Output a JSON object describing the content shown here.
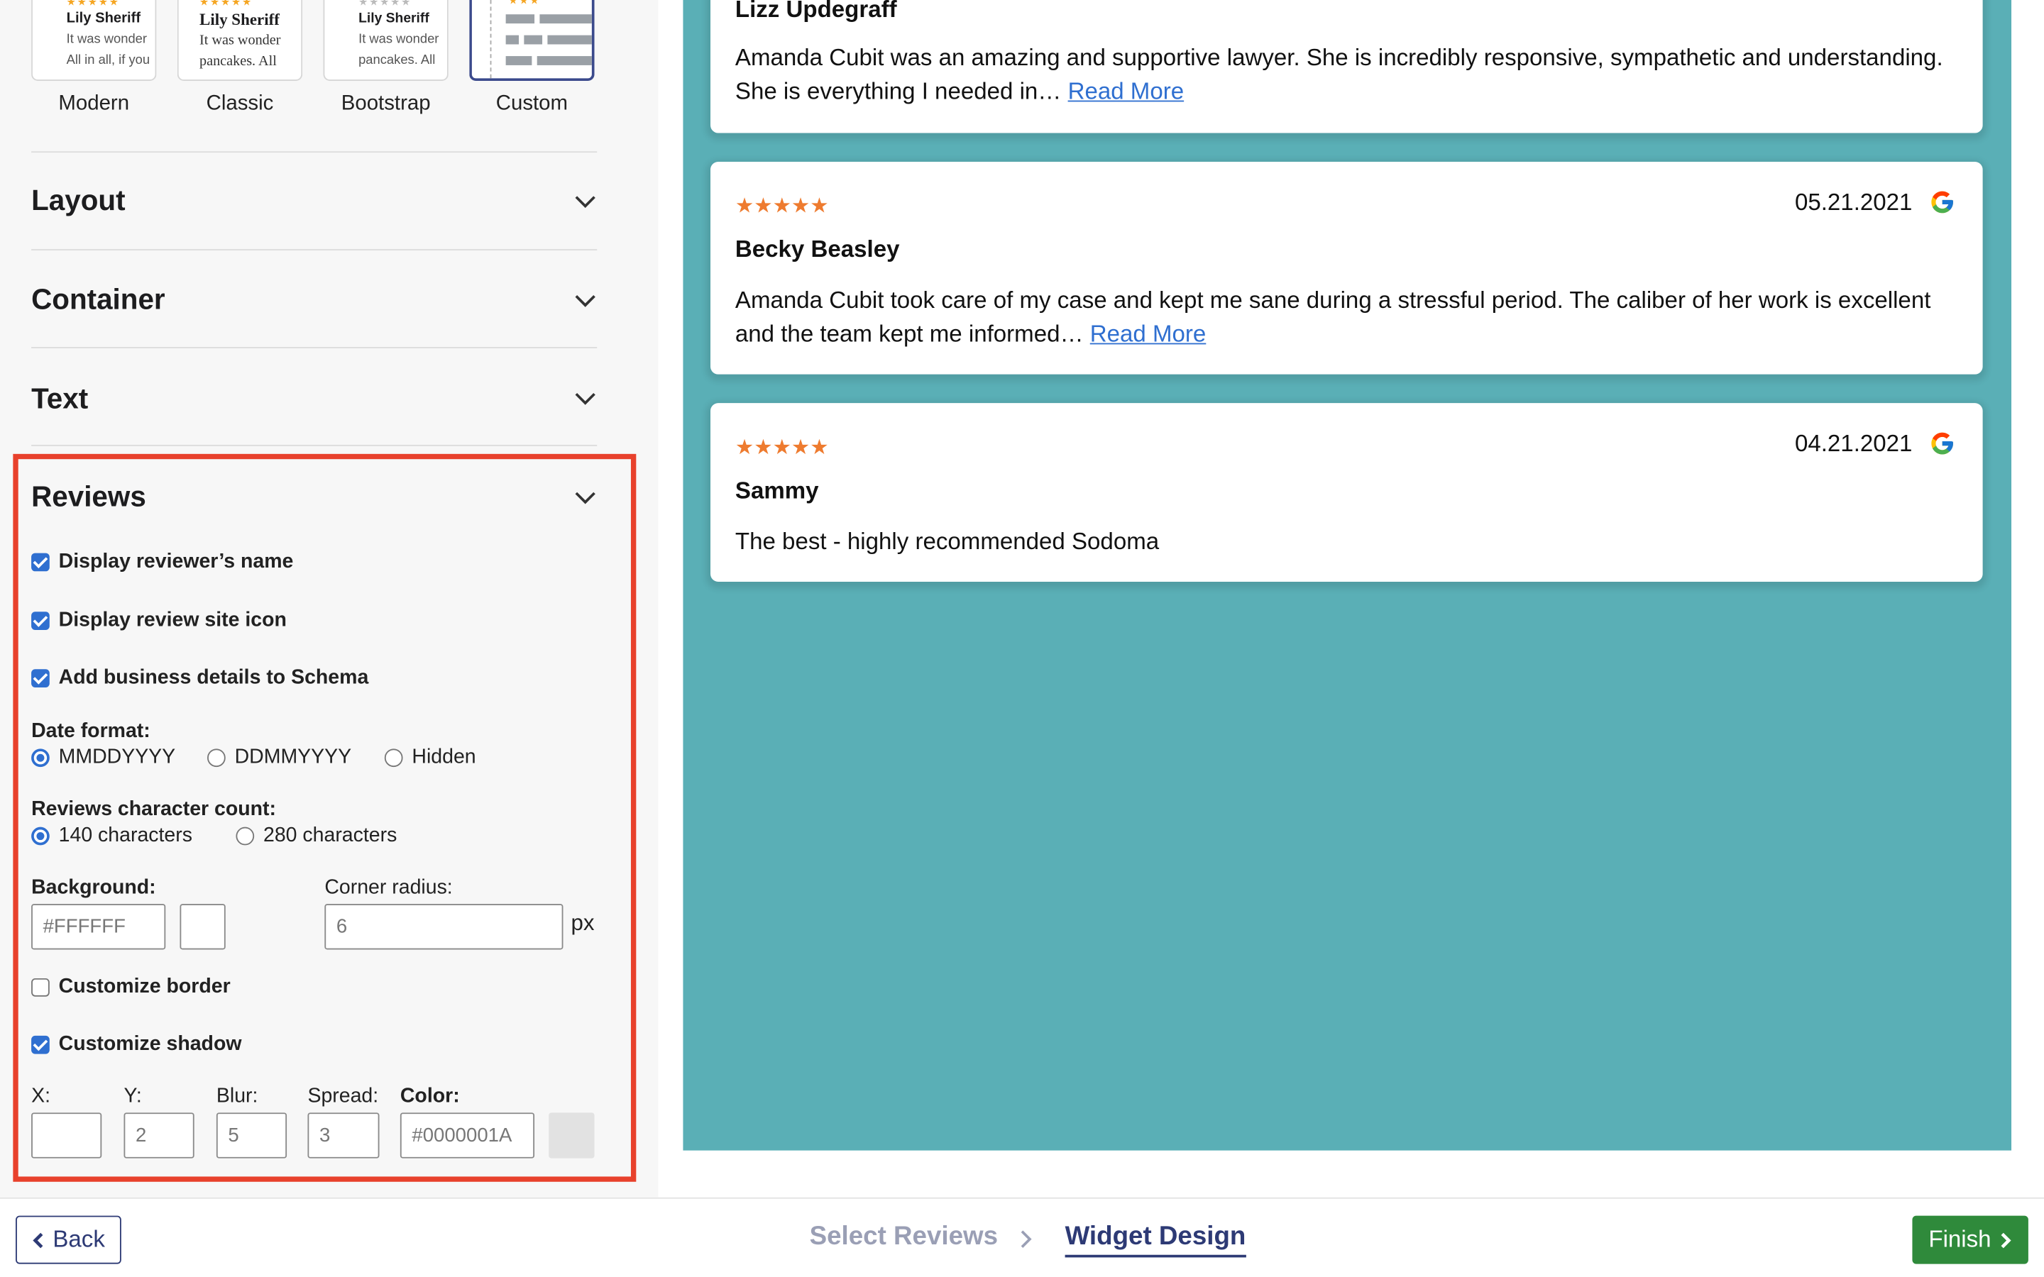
{
  "themes": [
    {
      "label": "Modern",
      "thumb_name": "Lily Sheriff",
      "thumb_line1": "It was wonder",
      "thumb_line2": "All in all, if you",
      "selected": false
    },
    {
      "label": "Classic",
      "thumb_name": "Lily Sheriff",
      "thumb_line1": "It was wonder",
      "thumb_line2": "pancakes. All",
      "selected": false
    },
    {
      "label": "Bootstrap",
      "thumb_name": "Lily Sheriff",
      "thumb_line1": "It was wonder",
      "thumb_line2": "pancakes. All",
      "selected": false
    },
    {
      "label": "Custom",
      "selected": true
    }
  ],
  "thumb_stars": "★★★★★",
  "sections": {
    "layout": "Layout",
    "container": "Container",
    "text": "Text",
    "reviews": "Reviews"
  },
  "reviews_settings": {
    "display_name": {
      "label": "Display reviewer’s name",
      "checked": true
    },
    "display_icon": {
      "label": "Display review site icon",
      "checked": true
    },
    "schema": {
      "label": "Add business details to Schema",
      "checked": true
    },
    "date_format": {
      "label": "Date format:",
      "options": [
        "MMDDYYYY",
        "DDMMYYYY",
        "Hidden"
      ],
      "selected": "MMDDYYYY"
    },
    "char_count": {
      "label": "Reviews character count:",
      "options": [
        "140 characters",
        "280 characters"
      ],
      "selected": "140 characters"
    },
    "background": {
      "label": "Background:",
      "value": "#FFFFFF",
      "swatch_color": "#FFFFFF"
    },
    "corner_radius": {
      "label": "Corner radius:",
      "value": "6",
      "unit": "px"
    },
    "customize_border": {
      "label": "Customize border",
      "checked": false
    },
    "customize_shadow": {
      "label": "Customize shadow",
      "checked": true
    },
    "shadow": {
      "x_label": "X:",
      "x_value": "",
      "y_label": "Y:",
      "y_value": "2",
      "blur_label": "Blur:",
      "blur_value": "5",
      "spread_label": "Spread:",
      "spread_value": "3",
      "color_label": "Color:",
      "color_value": "#0000001A",
      "swatch_color": "#e2e2e2"
    }
  },
  "preview": {
    "background_color": "#5aafb6",
    "read_more": "Read More",
    "reviews": [
      {
        "stars": "",
        "date": "",
        "name": "Lizz Updegraff",
        "text": "Amanda Cubit was an amazing and supportive lawyer. She is incredibly responsive, sympathetic and understanding. She is everything I needed in…",
        "has_more": true
      },
      {
        "stars": "★★★★★",
        "date": "05.21.2021",
        "name": "Becky Beasley",
        "text": "Amanda Cubit took care of my case and kept me sane during a stressful period. The caliber of her work is excellent and the team kept me informed…",
        "has_more": true
      },
      {
        "stars": "★★★★★",
        "date": "04.21.2021",
        "name": "Sammy",
        "text": "The best - highly recommended Sodoma",
        "has_more": false
      }
    ]
  },
  "footer": {
    "back_label": "Back",
    "steps": [
      "Select Reviews",
      "Widget Design"
    ],
    "active_step": "Widget Design",
    "finish_label": "Finish"
  },
  "colors": {
    "accent_blue": "#2f6fd0",
    "navy": "#2d3a75",
    "highlight_red": "#e8412c",
    "finish_green": "#2f8a3b",
    "star_orange": "#ee7b2f"
  }
}
